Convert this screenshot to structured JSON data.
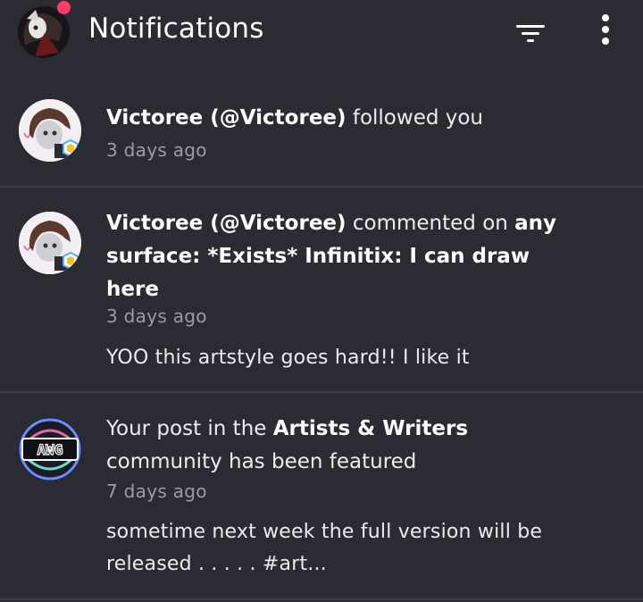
{
  "header": {
    "title": "Notifications",
    "filter_icon": "filter-icon",
    "more_icon": "more-vertical-icon",
    "badge_color": "#ff3a6e"
  },
  "notifications": [
    {
      "user": "Victoree (@Victoree)",
      "action": " followed you",
      "time": "3 days ago"
    },
    {
      "user": "Victoree (@Victoree)",
      "action": " commented on ",
      "target": "any surface: *Exists* Infinitix: I can draw here",
      "time": "3 days ago",
      "preview": "YOO this artstyle goes hard!! I like it"
    },
    {
      "prefix": "Your post in the ",
      "community": "Artists & Writers",
      "suffix": " community has been featured",
      "time": "7 days ago",
      "preview": "sometime next week the full version will be released . . . . . #art..."
    }
  ],
  "colors": {
    "background": "#2a2b33",
    "divider": "#3e3f47",
    "muted_text": "#9b9ca6"
  }
}
